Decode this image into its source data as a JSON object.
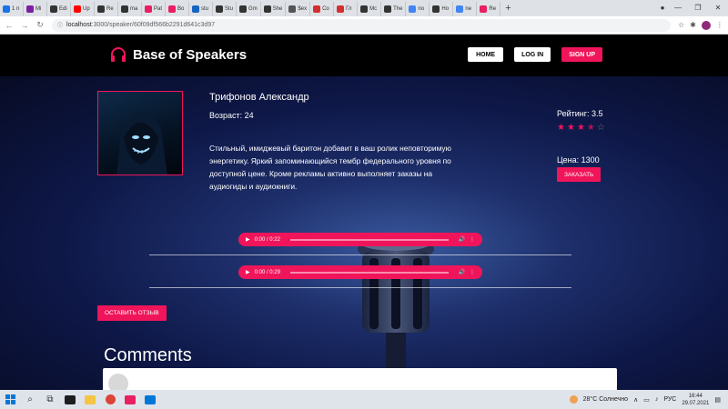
{
  "browser": {
    "tabs": [
      {
        "label": "1 n",
        "color": "#1a73e8"
      },
      {
        "label": "Mi",
        "color": "#7b1fa2"
      },
      {
        "label": "Edi",
        "color": "#333"
      },
      {
        "label": "Up",
        "color": "#ff0000"
      },
      {
        "label": "Re",
        "color": "#333"
      },
      {
        "label": "ma",
        "color": "#333"
      },
      {
        "label": "Pat",
        "color": "#e91e63"
      },
      {
        "label": "Bo",
        "color": "#e91e63"
      },
      {
        "label": "stu",
        "color": "#1565c0"
      },
      {
        "label": "Stu",
        "color": "#333"
      },
      {
        "label": "Gm",
        "color": "#333"
      },
      {
        "label": "She",
        "color": "#333"
      },
      {
        "label": "$ex",
        "color": "#555"
      },
      {
        "label": "Co",
        "color": "#d32f2f"
      },
      {
        "label": "Гл",
        "color": "#d32f2f"
      },
      {
        "label": "Mc",
        "color": "#333"
      },
      {
        "label": "The",
        "color": "#333"
      },
      {
        "label": "no",
        "color": "#4285f4"
      },
      {
        "label": "Ho",
        "color": "#333"
      },
      {
        "label": "ne",
        "color": "#4285f4"
      },
      {
        "label": "Re",
        "color": "#e91e63"
      }
    ],
    "active_tab_index": 21,
    "new_tab_label": "+",
    "url_host": "localhost",
    "url_rest": ":3000/speaker/60f09df566b2291d641c3d97"
  },
  "site": {
    "logo_text": "Base of Speakers",
    "nav": {
      "home": "HOME",
      "login": "LOG IN",
      "signup": "SIGN UP"
    }
  },
  "speaker": {
    "name": "Трифонов Александр",
    "age_label": "Возраст: 24",
    "description": "Стильный, имиджевый баритон добавит в ваш ролик неповторимую энергетику. Яркий запоминающийся тембр федерального уровня по доступной цене. Кроме рекламы активно выполняет заказы на аудиогиды и аудиокниги.",
    "rating_label": "Рейтинг: 3.5",
    "rating_value": 3.5,
    "rating_max": 5,
    "price_label": "Цена: 1300",
    "order_button": "ЗАКАЗАТЬ"
  },
  "audio": [
    {
      "time": "0:00 / 0:22"
    },
    {
      "time": "0:00 / 0:29"
    }
  ],
  "review_button": "ОСТАВИТЬ ОТЗЫВ",
  "comments_title": "Comments",
  "colors": {
    "accent": "#f0155a",
    "header_bg": "#000000"
  },
  "taskbar": {
    "weather": "28°C  Солнечно",
    "lang": "РУС",
    "time": "16:44",
    "date": "29.07.2021"
  }
}
